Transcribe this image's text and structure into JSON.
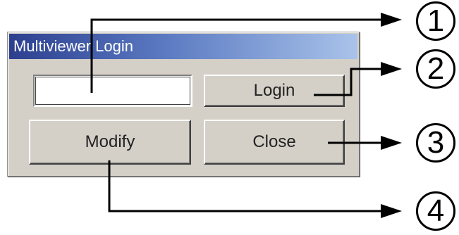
{
  "dialog": {
    "title": "Multiviewer Login",
    "password_value": "",
    "buttons": {
      "login": "Login",
      "modify": "Modify",
      "close": "Close"
    }
  },
  "callouts": {
    "n1": "1",
    "n2": "2",
    "n3": "3",
    "n4": "4"
  }
}
